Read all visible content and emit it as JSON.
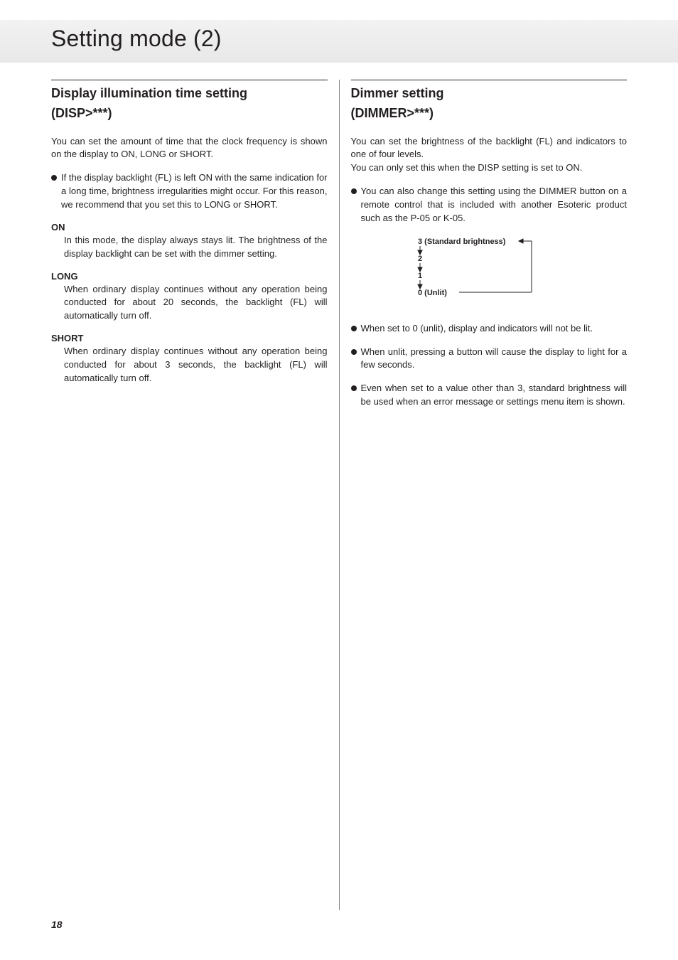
{
  "header": {
    "title": "Setting mode (2)"
  },
  "page_number": "18",
  "left": {
    "title": "Display illumination time setting",
    "subtitle": "(DISP>***)",
    "intro": "You can set the amount of time that the clock frequency is shown on the display to ON, LONG or SHORT.",
    "warn": "If the display backlight (FL) is left ON with the same indication for a long time, brightness irregularities might occur. For this reason, we recommend that you set this to LONG or SHORT.",
    "opts": {
      "on": {
        "name": "ON",
        "desc": "In this mode, the display always stays lit. The brightness of the display backlight can be set with the dimmer setting."
      },
      "long": {
        "name": "LONG",
        "desc": "When ordinary display continues without any operation being conducted for about 20 seconds, the backlight (FL) will automatically turn off."
      },
      "short": {
        "name": "SHORT",
        "desc": "When ordinary display continues without any operation being conducted for about 3 seconds, the backlight (FL) will automatically turn off."
      }
    }
  },
  "right": {
    "title": "Dimmer setting",
    "subtitle": "(DIMMER>***)",
    "intro": "You can set the brightness of the backlight (FL) and indicators to one of four levels.",
    "note": "You can only set this when the DISP setting is set to ON.",
    "bullet1": "You can also change this setting using the DIMMER button on a remote control that is included with another Esoteric product such as the P-05 or K-05.",
    "diagram": {
      "l3": "3 (Standard brightness)",
      "l2": "2",
      "l1": "1",
      "l0": "0 (Unlit)"
    },
    "b_unlit": "When set to 0 (unlit), display and indicators will not be lit.",
    "b_press": "When unlit, pressing a button will cause the display to light for a few seconds.",
    "b_std": "Even when set to a value other than 3, standard brightness will be used when an error message or settings menu item is shown."
  }
}
